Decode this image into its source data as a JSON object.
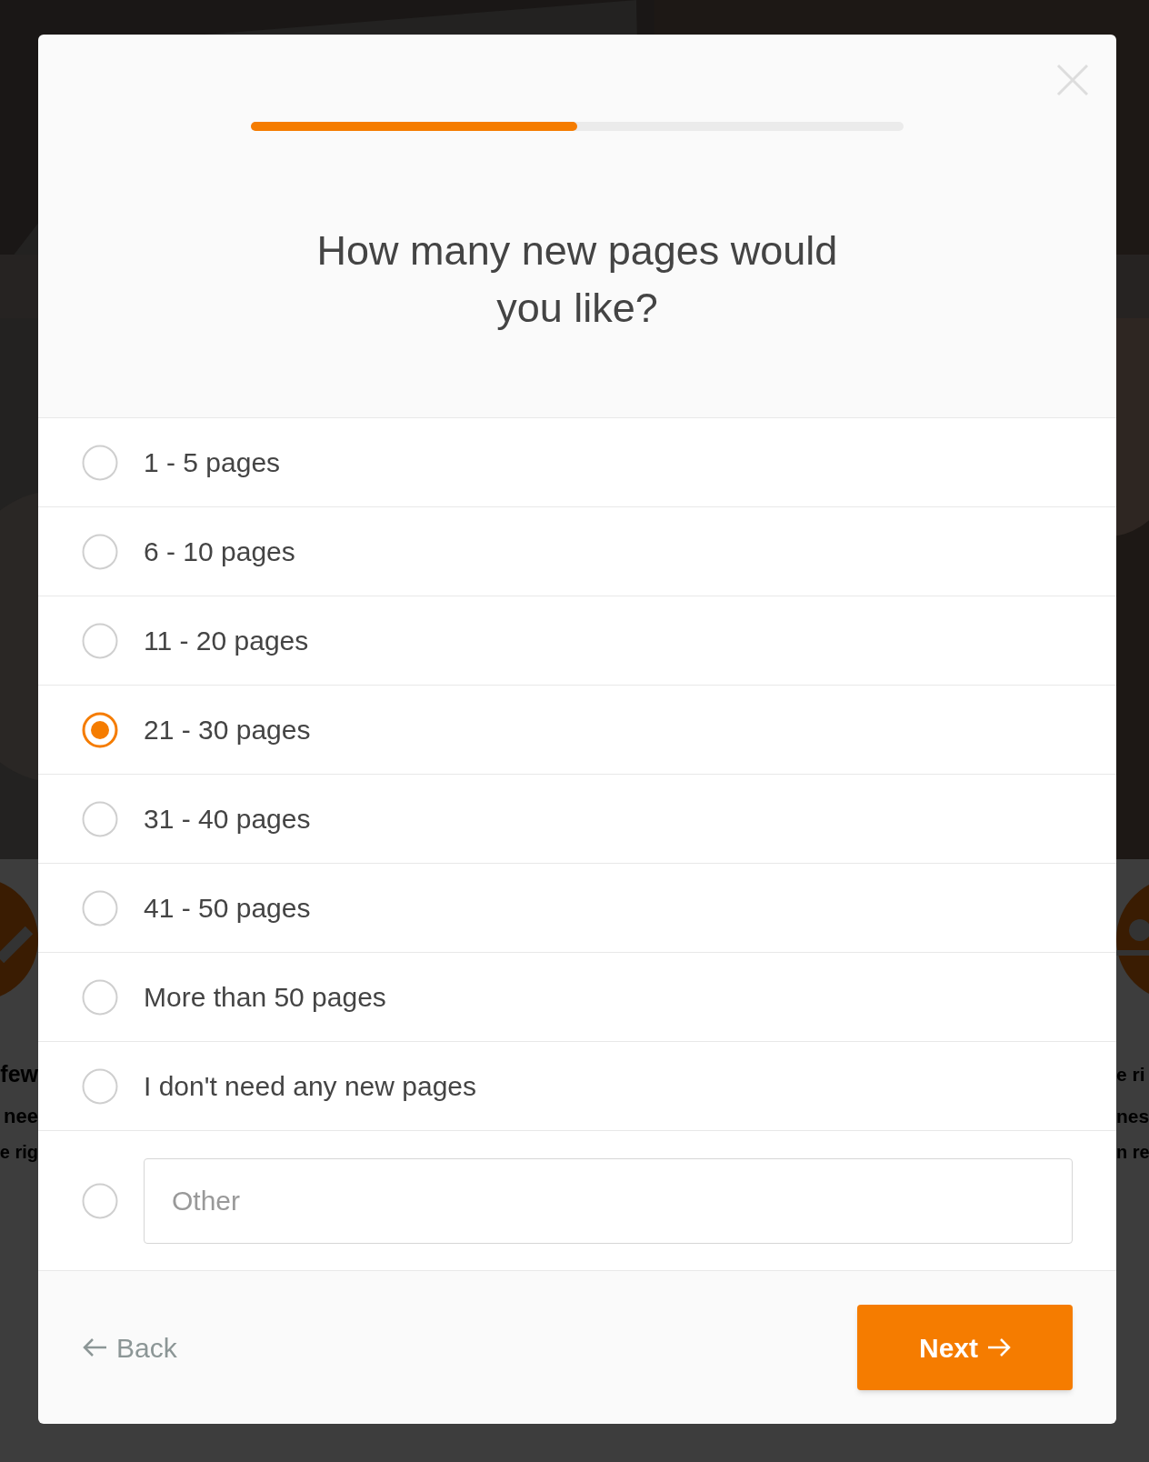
{
  "background": {
    "left_texts": [
      "few",
      "nee",
      "e rig"
    ],
    "right_texts": [
      "e ri",
      "nes",
      "n re"
    ]
  },
  "dialog": {
    "progress": {
      "level": 0.5
    },
    "title": "How many new pages would you like?",
    "options": [
      {
        "kind": "choice",
        "label": "1 - 5 pages",
        "selected": false
      },
      {
        "kind": "choice",
        "label": "6 - 10 pages",
        "selected": false
      },
      {
        "kind": "choice",
        "label": "11 - 20 pages",
        "selected": false
      },
      {
        "kind": "choice",
        "label": "21 - 30 pages",
        "selected": true
      },
      {
        "kind": "choice",
        "label": "31 - 40 pages",
        "selected": false
      },
      {
        "kind": "choice",
        "label": "41 - 50 pages",
        "selected": false
      },
      {
        "kind": "choice",
        "label": "More than 50 pages",
        "selected": false
      },
      {
        "kind": "choice",
        "label": "I don't need any new pages",
        "selected": false
      },
      {
        "kind": "other",
        "placeholder": "Other",
        "selected": false
      }
    ],
    "back_button": "Back",
    "next_button": "Next"
  }
}
